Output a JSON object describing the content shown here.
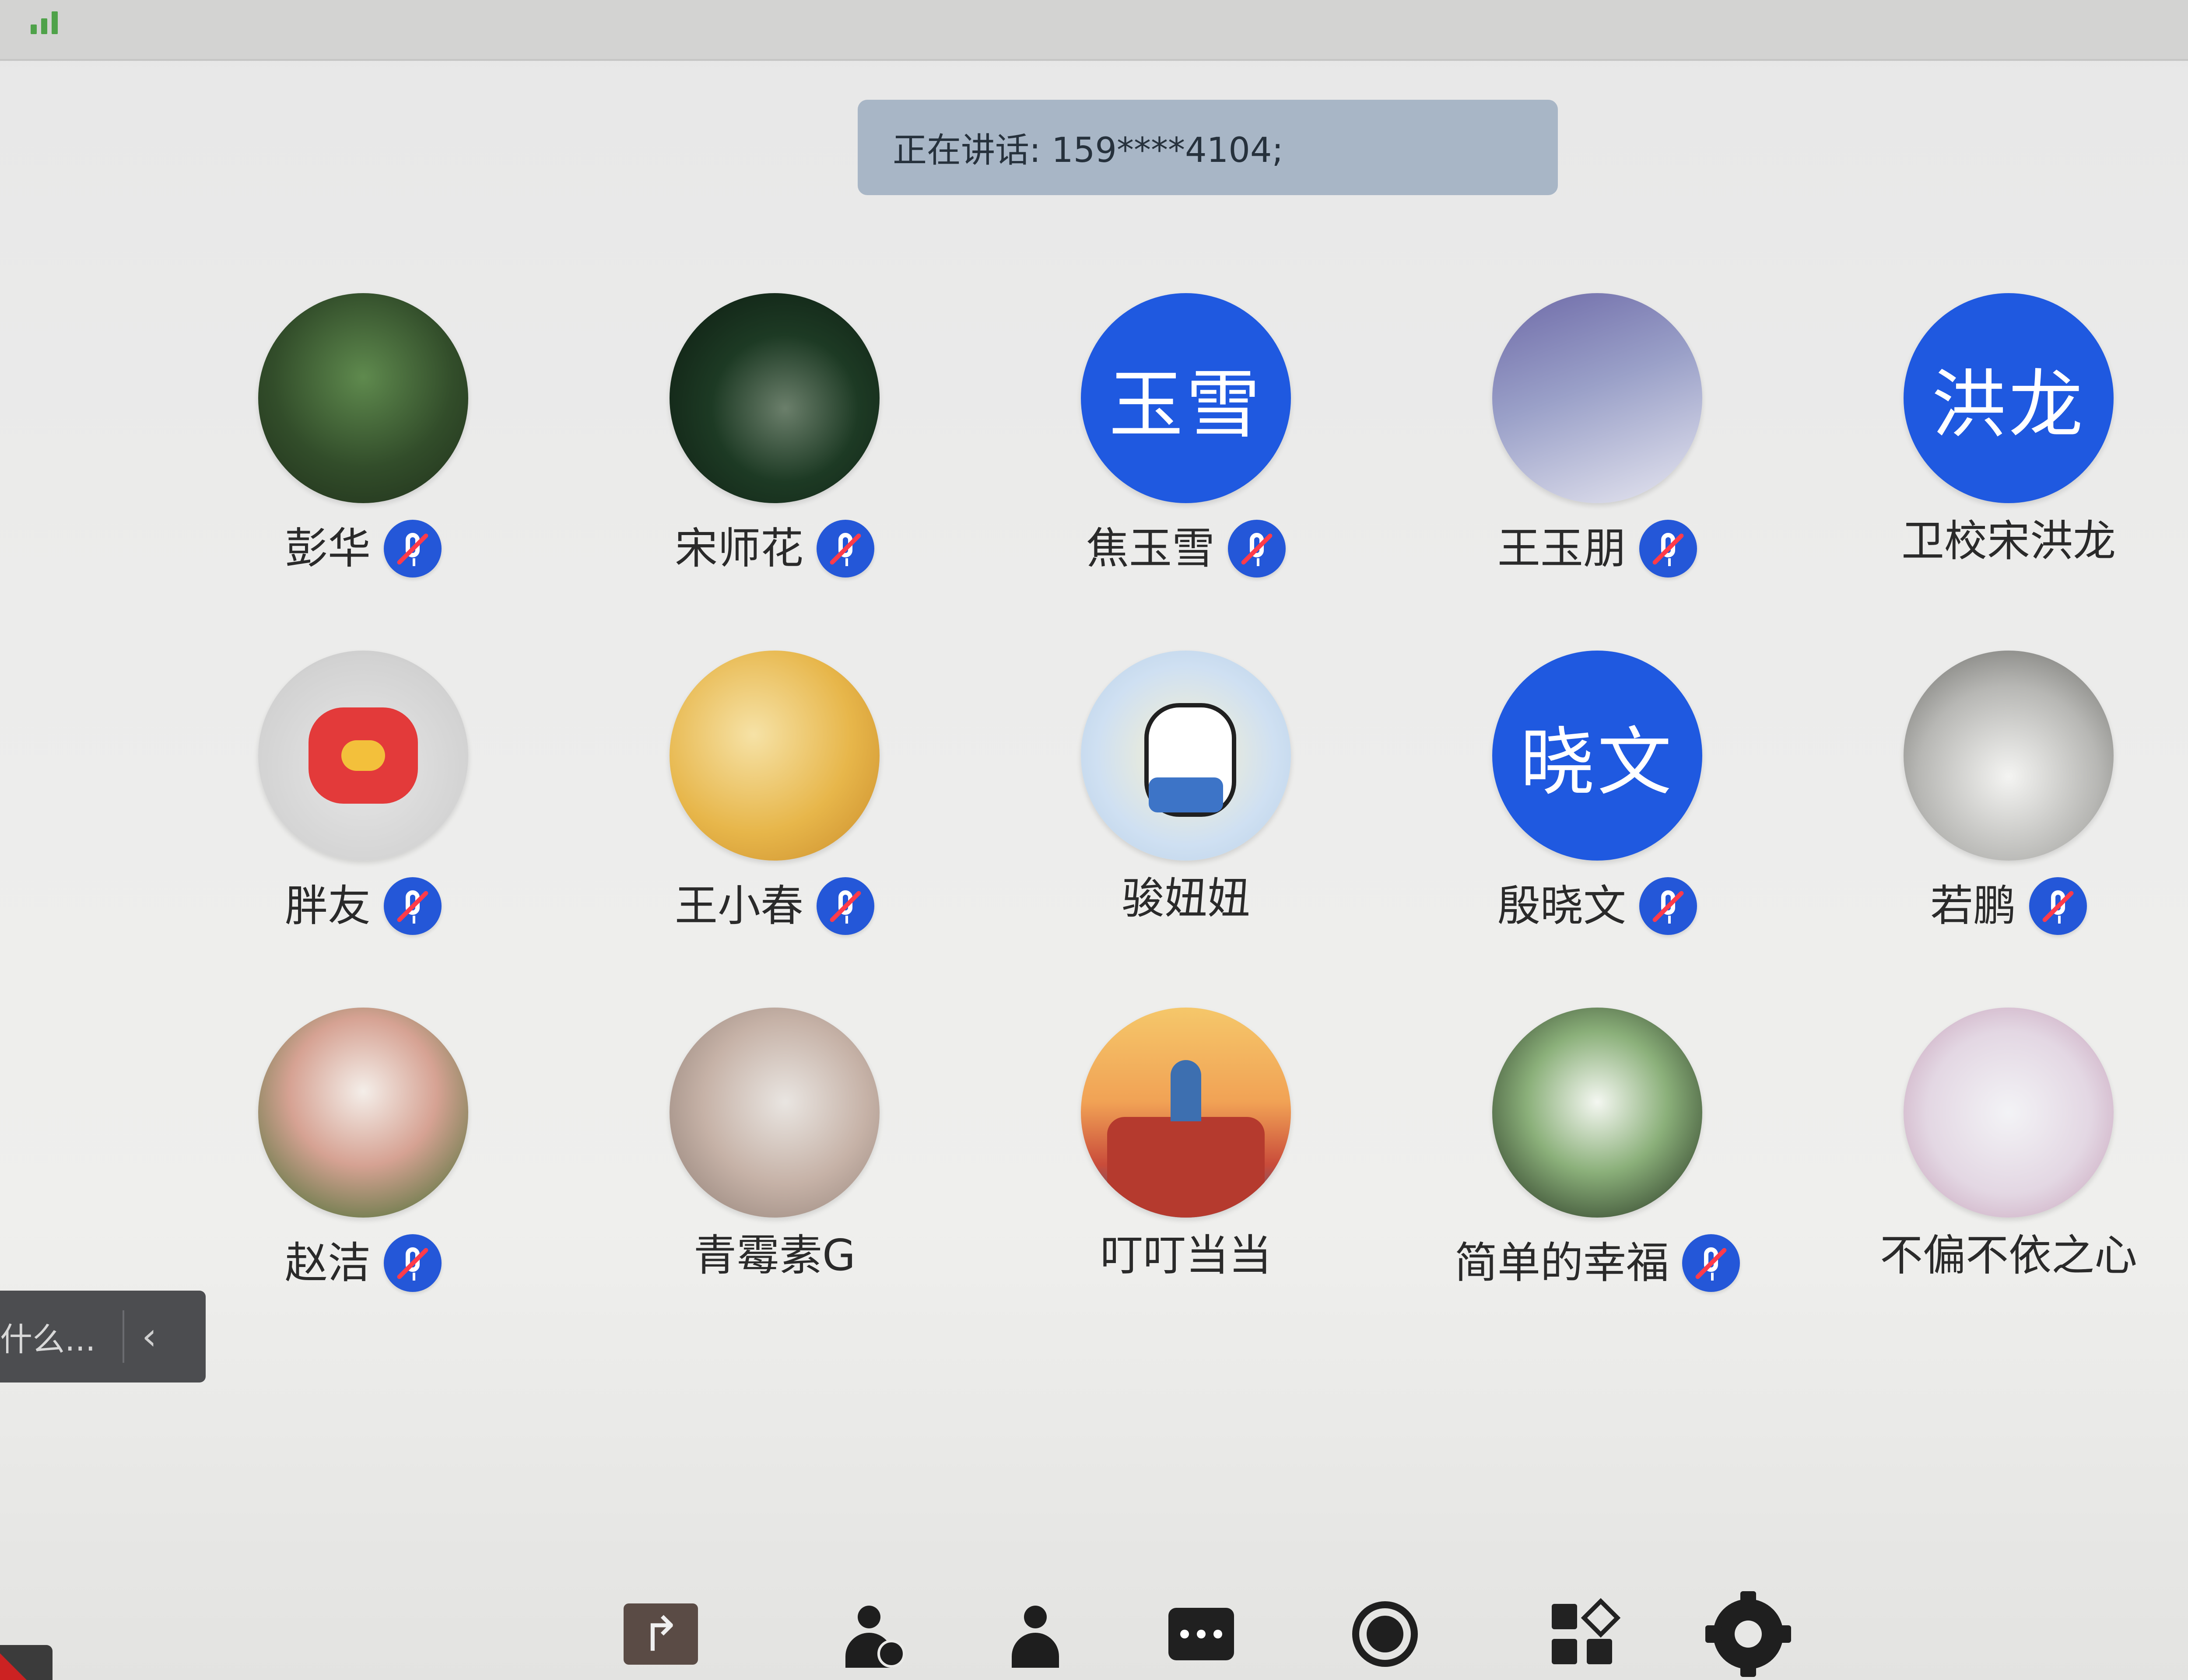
{
  "status": {
    "signal_icon": "signal-bars-icon"
  },
  "speaking_banner": {
    "text": "正在讲话: 159****4104;"
  },
  "members": [
    {
      "name": "彭华",
      "avatar_type": "image",
      "muted": true
    },
    {
      "name": "宋师花",
      "avatar_type": "image",
      "muted": true
    },
    {
      "name": "焦玉雪",
      "avatar_type": "text",
      "avatar_text": "玉雪",
      "muted": true
    },
    {
      "name": "王玉朋",
      "avatar_type": "image",
      "muted": true
    },
    {
      "name": "卫校宋洪龙",
      "avatar_type": "text",
      "avatar_text": "洪龙",
      "muted": false
    },
    {
      "name": "胖友",
      "avatar_type": "image",
      "muted": true
    },
    {
      "name": "王小春",
      "avatar_type": "image",
      "muted": true
    },
    {
      "name": "骏妞妞",
      "avatar_type": "image",
      "muted": false
    },
    {
      "name": "殷晓文",
      "avatar_type": "text",
      "avatar_text": "晓文",
      "muted": true
    },
    {
      "name": "若鹏",
      "avatar_type": "image",
      "muted": true
    },
    {
      "name": "赵洁",
      "avatar_type": "image",
      "muted": true
    },
    {
      "name": "青霉素G",
      "avatar_type": "image",
      "muted": false
    },
    {
      "name": "叮叮当当",
      "avatar_type": "image",
      "muted": false
    },
    {
      "name": "简单的幸福",
      "avatar_type": "image",
      "muted": true
    },
    {
      "name": "不偏不依之心",
      "avatar_type": "image",
      "muted": false
    }
  ],
  "side_tab": {
    "text": "什么...",
    "chevron": "‹"
  },
  "toolbar": {
    "share_glyph": "↱",
    "icons": [
      "share-icon",
      "member-clock-icon",
      "member-icon",
      "chat-icon",
      "record-icon",
      "apps-icon",
      "gear-icon"
    ]
  },
  "colors": {
    "accent_blue": "#1f59e0",
    "mic_blue": "#2457d8",
    "mute_red": "#ff3b4a",
    "banner_bg": "#a8b6c6"
  }
}
